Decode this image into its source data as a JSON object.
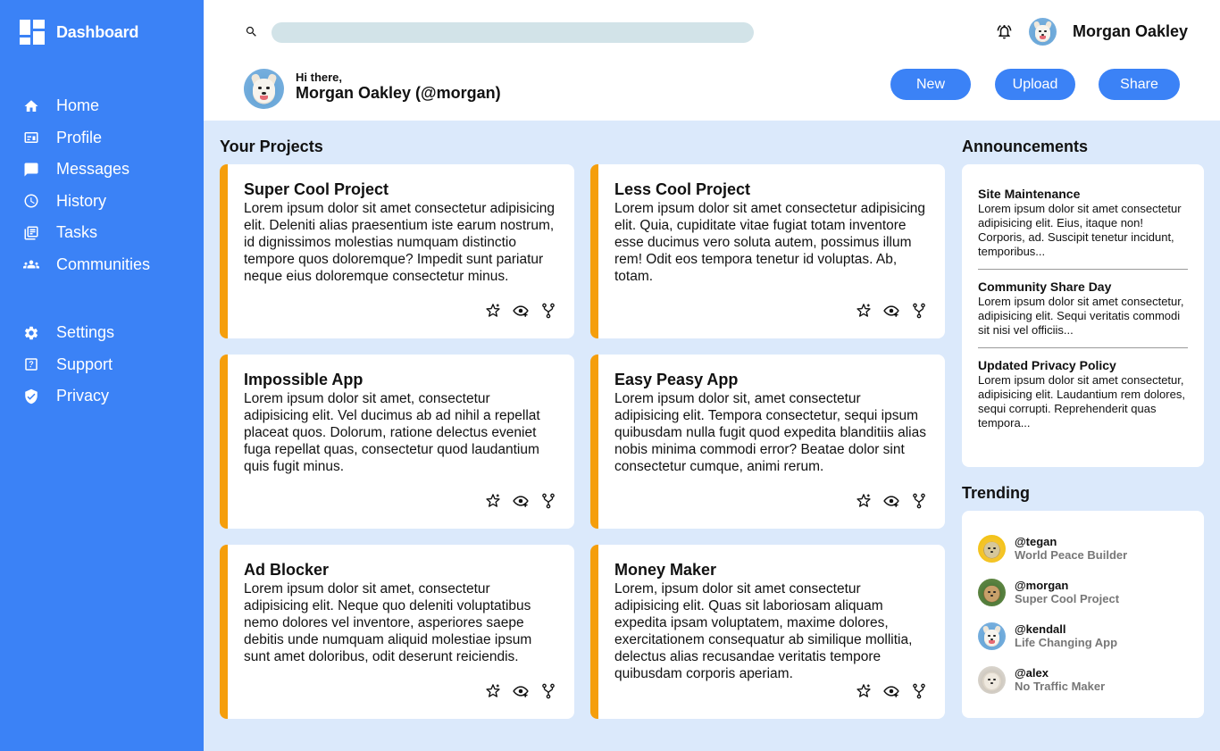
{
  "sidebar": {
    "brand": "Dashboard",
    "nav": [
      {
        "label": "Home",
        "icon": "home-icon"
      },
      {
        "label": "Profile",
        "icon": "id-card-icon"
      },
      {
        "label": "Messages",
        "icon": "chat-icon"
      },
      {
        "label": "History",
        "icon": "clock-icon"
      },
      {
        "label": "Tasks",
        "icon": "documents-icon"
      },
      {
        "label": "Communities",
        "icon": "people-icon"
      }
    ],
    "nav2": [
      {
        "label": "Settings",
        "icon": "gear-icon"
      },
      {
        "label": "Support",
        "icon": "help-icon"
      },
      {
        "label": "Privacy",
        "icon": "shield-icon"
      }
    ]
  },
  "header": {
    "search_placeholder": "",
    "user_name": "Morgan Oakley",
    "greeting": "Hi there,",
    "greeting_name": "Morgan Oakley (@morgan)",
    "buttons": {
      "new": "New",
      "upload": "Upload",
      "share": "Share"
    }
  },
  "projects": {
    "title": "Your Projects",
    "items": [
      {
        "title": "Super Cool Project",
        "body": "Lorem ipsum dolor sit amet consectetur adipisicing elit. Deleniti alias praesentium iste earum nostrum, id dignissimos molestias numquam distinctio tempore quos doloremque? Impedit sunt pariatur neque eius doloremque consectetur minus."
      },
      {
        "title": "Less Cool Project",
        "body": "Lorem ipsum dolor sit amet consectetur adipisicing elit. Quia, cupiditate vitae fugiat totam inventore esse ducimus vero soluta autem, possimus illum rem! Odit eos tempora tenetur id voluptas. Ab, totam."
      },
      {
        "title": "Impossible App",
        "body": "Lorem ipsum dolor sit amet, consectetur adipisicing elit. Vel ducimus ab ad nihil a repellat placeat quos. Dolorum, ratione delectus eveniet fuga repellat quas, consectetur quod laudantium quis fugit minus."
      },
      {
        "title": "Easy Peasy App",
        "body": "Lorem ipsum dolor sit, amet consectetur adipisicing elit. Tempora consectetur, sequi ipsum quibusdam nulla fugit quod expedita blanditiis alias nobis minima commodi error? Beatae dolor sint consectetur cumque, animi rerum."
      },
      {
        "title": "Ad Blocker",
        "body": "Lorem ipsum dolor sit amet, consectetur adipisicing elit. Neque quo deleniti voluptatibus nemo dolores vel inventore, asperiores saepe debitis unde numquam aliquid molestiae ipsum sunt amet doloribus, odit deserunt reiciendis."
      },
      {
        "title": "Money Maker",
        "body": "Lorem, ipsum dolor sit amet consectetur adipisicing elit. Quas sit laboriosam aliquam expedita ipsam voluptatem, maxime dolores, exercitationem consequatur ab similique mollitia, delectus alias recusandae veritatis tempore quibusdam corporis aperiam."
      }
    ]
  },
  "announcements": {
    "title": "Announcements",
    "items": [
      {
        "title": "Site Maintenance",
        "body": "Lorem ipsum dolor sit amet consectetur adipisicing elit. Eius, itaque non! Corporis, ad. Suscipit tenetur incidunt, temporibus..."
      },
      {
        "title": "Community Share Day",
        "body": "Lorem ipsum dolor sit amet consectetur, adipisicing elit. Sequi veritatis commodi sit nisi vel officiis..."
      },
      {
        "title": "Updated Privacy Policy",
        "body": "Lorem ipsum dolor sit amet consectetur, adipisicing elit. Laudantium rem dolores, sequi corrupti. Reprehenderit quas tempora..."
      }
    ]
  },
  "trending": {
    "title": "Trending",
    "items": [
      {
        "handle": "@tegan",
        "project": "World Peace Builder"
      },
      {
        "handle": "@morgan",
        "project": "Super Cool Project"
      },
      {
        "handle": "@kendall",
        "project": "Life Changing App"
      },
      {
        "handle": "@alex",
        "project": "No Traffic Maker"
      }
    ]
  },
  "colors": {
    "accent": "#3b82f6",
    "card_border": "#f59e0b",
    "background": "#dbe9fb"
  }
}
